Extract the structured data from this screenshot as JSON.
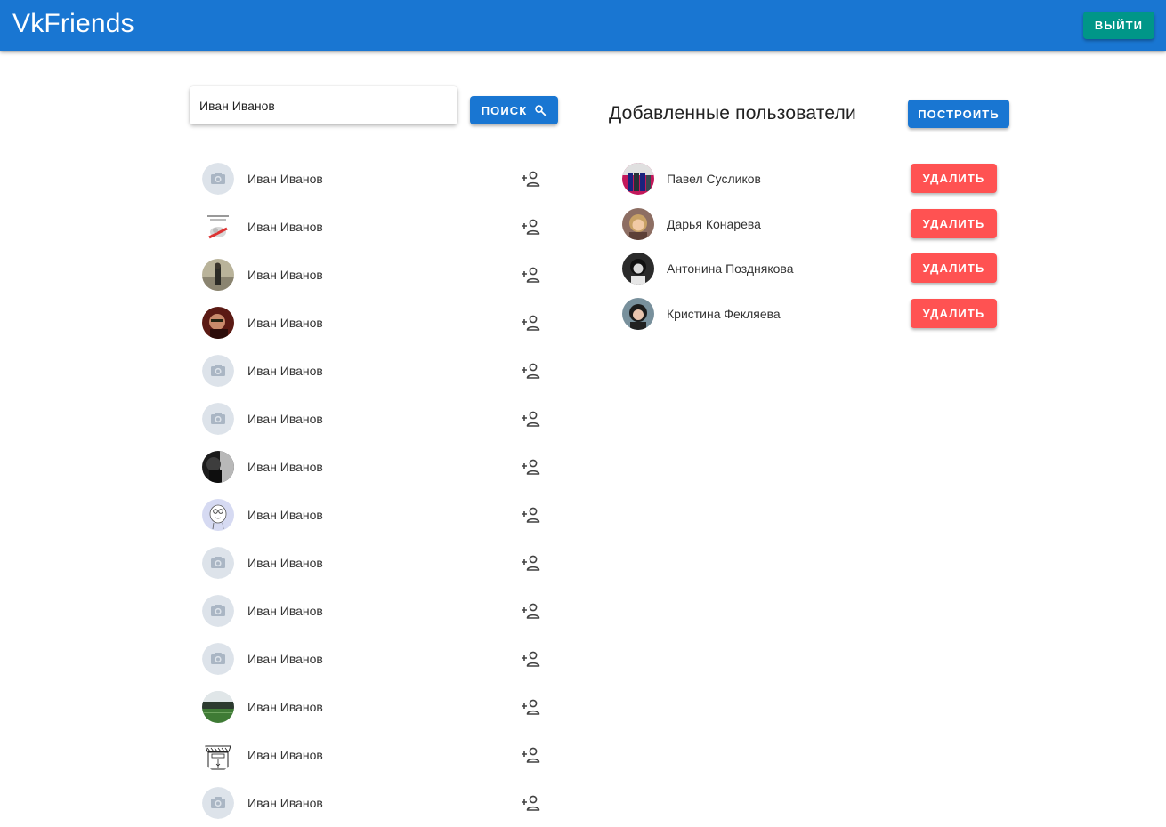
{
  "app": {
    "title": "VkFriends",
    "logout_label": "ВЫЙТИ"
  },
  "search": {
    "value": "Иван Иванов",
    "button_label": "ПОИСК"
  },
  "results": [
    {
      "name": "Иван Иванов",
      "avatar": "camera-placeholder"
    },
    {
      "name": "Иван Иванов",
      "avatar": "meme-image"
    },
    {
      "name": "Иван Иванов",
      "avatar": "photo-outdoor"
    },
    {
      "name": "Иван Иванов",
      "avatar": "photo-red"
    },
    {
      "name": "Иван Иванов",
      "avatar": "camera-placeholder"
    },
    {
      "name": "Иван Иванов",
      "avatar": "camera-placeholder"
    },
    {
      "name": "Иван Иванов",
      "avatar": "photo-dark"
    },
    {
      "name": "Иван Иванов",
      "avatar": "cartoon-face"
    },
    {
      "name": "Иван Иванов",
      "avatar": "camera-placeholder"
    },
    {
      "name": "Иван Иванов",
      "avatar": "camera-placeholder"
    },
    {
      "name": "Иван Иванов",
      "avatar": "camera-placeholder"
    },
    {
      "name": "Иван Иванов",
      "avatar": "photo-stadium"
    },
    {
      "name": "Иван Иванов",
      "avatar": "shop-sketch"
    },
    {
      "name": "Иван Иванов",
      "avatar": "camera-placeholder"
    }
  ],
  "added": {
    "title": "Добавленные пользователи",
    "build_label": "ПОСТРОИТЬ",
    "delete_label": "УДАЛИТЬ",
    "users": [
      {
        "name": "Павел Сусликов",
        "avatar": "photo-group"
      },
      {
        "name": "Дарья Конарева",
        "avatar": "photo-blonde"
      },
      {
        "name": "Антонина Позднякова",
        "avatar": "photo-bw"
      },
      {
        "name": "Кристина Фекляева",
        "avatar": "photo-dark-hair"
      }
    ]
  },
  "colors": {
    "primary": "#1976d2",
    "exit": "#009688",
    "delete": "#ff5252"
  }
}
